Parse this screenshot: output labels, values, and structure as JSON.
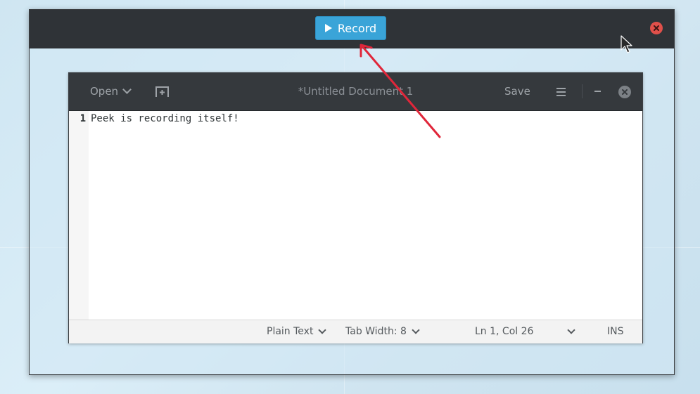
{
  "peek": {
    "record_label": "Record",
    "accent_color": "#3aa4d8",
    "close_color": "#e0504a"
  },
  "gedit": {
    "open_label": "Open",
    "title": "*Untitled Document 1",
    "save_label": "Save",
    "line_numbers": [
      "1"
    ],
    "lines": [
      "Peek is recording itself!"
    ],
    "status": {
      "language": "Plain Text",
      "tab_width": "Tab Width: 8",
      "position": "Ln 1, Col 26",
      "mode": "INS"
    }
  },
  "annotation": {
    "arrow_color": "#e0263a"
  }
}
